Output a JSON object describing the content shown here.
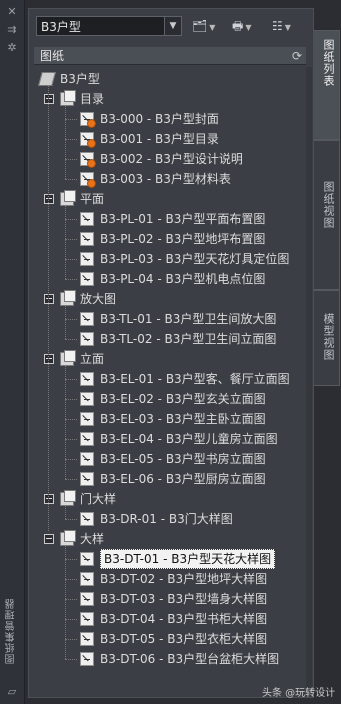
{
  "left_bar": {
    "title": "图纸集管理器",
    "icons": [
      "close-icon",
      "pin-icon",
      "settings-icon"
    ]
  },
  "toolbar": {
    "sheetset_value": "B3户型"
  },
  "panel": {
    "header": "图纸"
  },
  "tree": {
    "root": "B3户型",
    "groups": [
      {
        "name": "目录",
        "items": [
          {
            "label": "B3-000 - B3户型封面",
            "warn": true
          },
          {
            "label": "B3-001 - B3户型目录",
            "warn": true
          },
          {
            "label": "B3-002 - B3户型设计说明",
            "warn": true
          },
          {
            "label": "B3-003 - B3户型材料表",
            "warn": true
          }
        ]
      },
      {
        "name": "平面",
        "items": [
          {
            "label": "B3-PL-01 - B3户型平面布置图"
          },
          {
            "label": "B3-PL-02 - B3户型地坪布置图"
          },
          {
            "label": "B3-PL-03 - B3户型天花灯具定位图"
          },
          {
            "label": "B3-PL-04 - B3户型机电点位图"
          }
        ]
      },
      {
        "name": "放大图",
        "items": [
          {
            "label": "B3-TL-01 - B3户型卫生间放大图"
          },
          {
            "label": "B3-TL-02 - B3户型卫生间立面图"
          }
        ]
      },
      {
        "name": "立面",
        "items": [
          {
            "label": "B3-EL-01 - B3户型客、餐厅立面图"
          },
          {
            "label": "B3-EL-02 - B3户型玄关立面图"
          },
          {
            "label": "B3-EL-03 - B3户型主卧立面图"
          },
          {
            "label": "B3-EL-04 - B3户型儿童房立面图"
          },
          {
            "label": "B3-EL-05 - B3户型书房立面图"
          },
          {
            "label": "B3-EL-06 - B3户型厨房立面图"
          }
        ]
      },
      {
        "name": "门大样",
        "items": [
          {
            "label": "B3-DR-01 - B3门大样图"
          }
        ]
      },
      {
        "name": "大样",
        "items": [
          {
            "label": "B3-DT-01 - B3户型天花大样图",
            "selected": true
          },
          {
            "label": "B3-DT-02 - B3户型地坪大样图"
          },
          {
            "label": "B3-DT-03 - B3户型墙身大样图"
          },
          {
            "label": "B3-DT-04 - B3户型书柜大样图"
          },
          {
            "label": "B3-DT-05 - B3户型衣柜大样图"
          },
          {
            "label": "B3-DT-06 - B3户型台盆柜大样图"
          }
        ]
      }
    ]
  },
  "right_tabs": [
    {
      "label": "图纸列表",
      "active": true
    },
    {
      "label": "图纸视图",
      "active": false
    },
    {
      "label": "模型视图",
      "active": false
    }
  ],
  "watermark": "头条 @玩转设计"
}
